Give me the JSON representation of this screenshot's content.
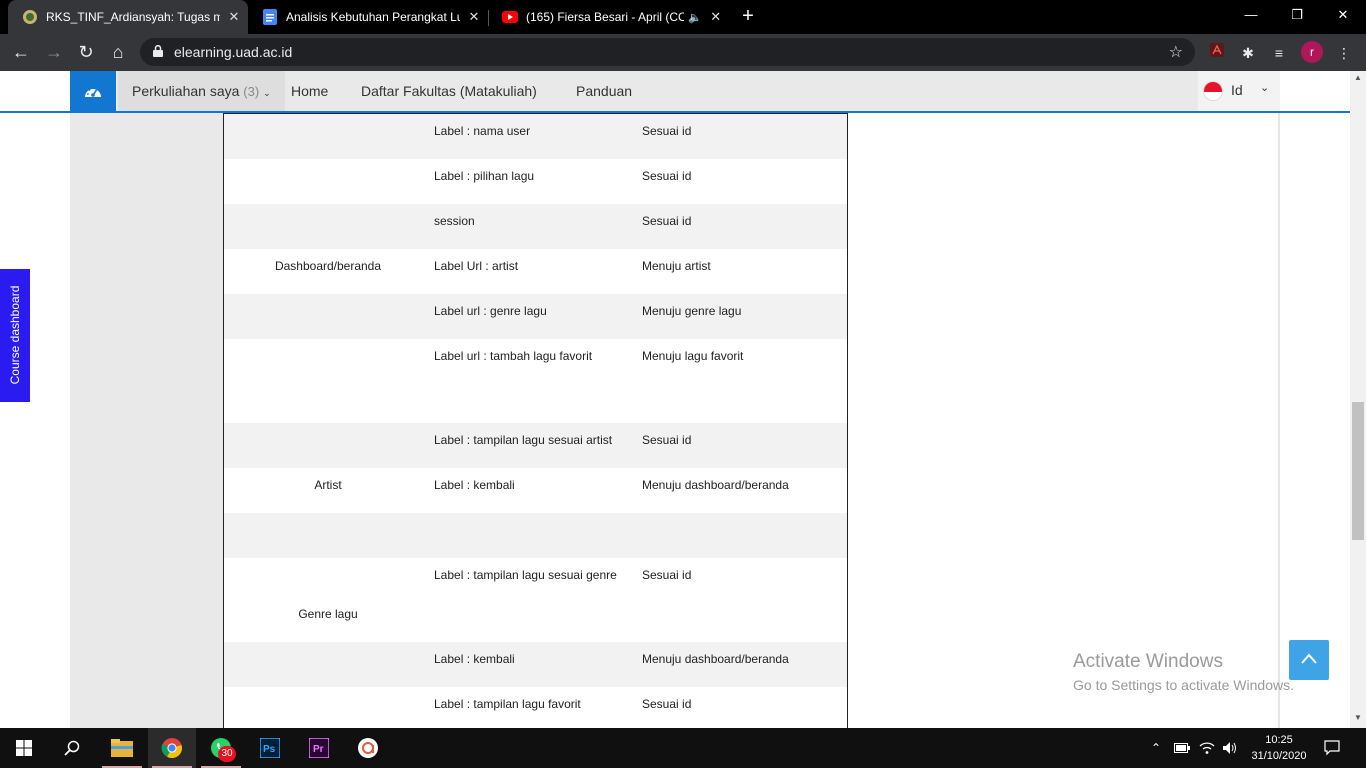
{
  "browser": {
    "tabs": [
      {
        "title": "RKS_TINF_Ardiansyah: Tugas mer",
        "favicon": "uad-logo-icon",
        "active": true
      },
      {
        "title": "Analisis Kebutuhan Perangkat Lu",
        "favicon": "google-docs-icon",
        "active": false
      },
      {
        "title": "(165) Fiersa Besari - April (CO",
        "favicon": "youtube-icon",
        "active": false,
        "audio": true
      }
    ],
    "url": "elearning.uad.ac.id",
    "profile_initial": "r"
  },
  "navbar": {
    "items": [
      {
        "label": "Perkuliahan saya",
        "count": "(3)"
      },
      {
        "label": "Home"
      },
      {
        "label": "Daftar Fakultas (Matakuliah)"
      },
      {
        "label": "Panduan"
      }
    ],
    "language": "Id",
    "accent_color": "#1177d1"
  },
  "course_dashboard_label": "Course dashboard",
  "table": {
    "rows": [
      {
        "page": "",
        "element": "Label : nama user",
        "result": "Sesuai id",
        "shaded": true
      },
      {
        "page": "",
        "element": "Label : pilihan lagu",
        "result": "Sesuai id",
        "shaded": false
      },
      {
        "page": "",
        "element": "session",
        "result": "Sesuai id",
        "shaded": true
      },
      {
        "page": "Dashboard/beranda",
        "element": "Label Url : artist",
        "result": "Menuju artist",
        "shaded": false
      },
      {
        "page": "",
        "element": "Label url : genre lagu",
        "result": "Menuju genre lagu",
        "shaded": true
      },
      {
        "page": "",
        "element": "Label url : tambah lagu favorit",
        "result": "Menuju lagu favorit",
        "shaded": false
      },
      {
        "page": "",
        "element": "Label : tampilan lagu sesuai artist",
        "result": "Sesuai id",
        "shaded": true
      },
      {
        "page": "Artist",
        "element": "Label : kembali",
        "result": "Menuju dashboard/beranda",
        "shaded": false
      },
      {
        "page": "",
        "element": "",
        "result": "",
        "shaded": true
      },
      {
        "page": "Genre lagu",
        "element": "Label : tampilan lagu sesuai genre",
        "result": "Sesuai id",
        "shaded": false
      },
      {
        "page": "",
        "element": "Label : kembali",
        "result": "Menuju dashboard/beranda",
        "shaded": true
      },
      {
        "page": "",
        "element": "Label : tampilan lagu favorit",
        "result": "Sesuai id",
        "shaded": false
      }
    ]
  },
  "watermark": {
    "title": "Activate Windows",
    "subtitle": "Go to Settings to activate Windows."
  },
  "taskbar": {
    "apps": [
      "start-icon",
      "search-icon",
      "file-explorer-icon",
      "chrome-icon",
      "whatsapp-icon",
      "photoshop-icon",
      "premiere-icon",
      "app-icon"
    ],
    "whatsapp_badge": "30",
    "time": "10:25",
    "date": "31/10/2020"
  }
}
